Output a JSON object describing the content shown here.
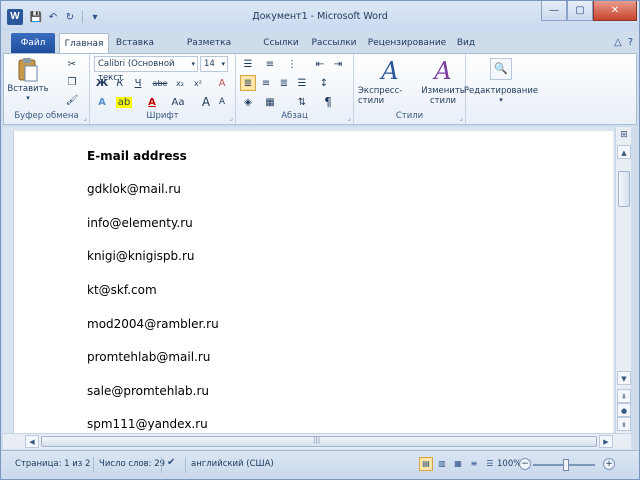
{
  "window": {
    "title": "Документ1 - Microsoft Word",
    "app_icon": "W"
  },
  "quick_access": {
    "save_icon": "💾",
    "undo_icon": "↶",
    "redo_icon": "↻",
    "customize_icon": "▾"
  },
  "window_controls": {
    "minimize": "—",
    "maximize": "▢",
    "close": "✕"
  },
  "tabs": [
    {
      "label": "Файл"
    },
    {
      "label": "Главная"
    },
    {
      "label": "Вставка"
    },
    {
      "label": "Разметка страницы"
    },
    {
      "label": "Ссылки"
    },
    {
      "label": "Рассылки"
    },
    {
      "label": "Рецензирование"
    },
    {
      "label": "Вид"
    }
  ],
  "tab_right": {
    "minimize_ribbon": "△",
    "help": "?"
  },
  "ribbon": {
    "clipboard": {
      "label": "Буфер обмена",
      "paste_label": "Вставить",
      "paste_arrow": "▾"
    },
    "font": {
      "label": "Шрифт",
      "font_name": "Calibri (Основной текст",
      "font_size": "14",
      "bold": "Ж",
      "italic": "К",
      "underline": "Ч",
      "strike": "abe",
      "subscript": "x₂",
      "superscript": "x²",
      "grow": "A",
      "shrink": "A",
      "case": "Aa",
      "clear": "A"
    },
    "paragraph": {
      "label": "Абзац",
      "pilcrow": "¶"
    },
    "styles": {
      "label": "Стили",
      "quick_styles": "Экспресс-стили",
      "change_styles_line1": "Изменить",
      "change_styles_line2": "стили"
    },
    "editing": {
      "label": "Редактирование",
      "arrow": "▾"
    }
  },
  "document": {
    "lines": [
      "E-mail address",
      "gdklok@mail.ru",
      "info@elementy.ru",
      "knigi@knigispb.ru",
      "kt@skf.com",
      "mod2004@rambler.ru",
      "promtehlab@mail.ru",
      "sale@promtehlab.ru",
      "spm111@yandex.ru"
    ]
  },
  "statusbar": {
    "page": "Страница: 1 из 2",
    "words": "Число слов: 29",
    "language": "английский (США)",
    "zoom": "100%",
    "zoom_minus": "−",
    "zoom_plus": "+"
  }
}
